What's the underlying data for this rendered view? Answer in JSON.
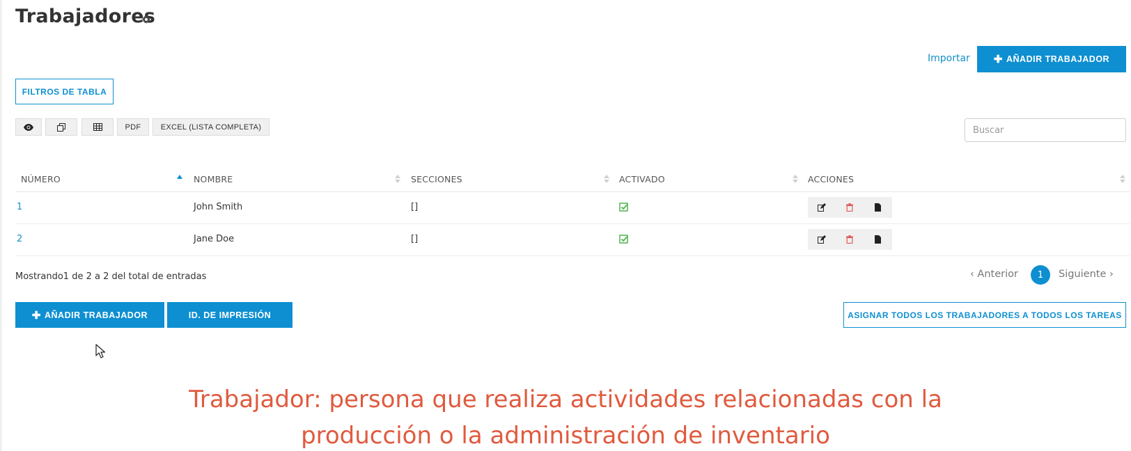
{
  "page": {
    "title": "Trabajadores",
    "title_icon": "gear-icon"
  },
  "header_actions": {
    "import_label": "Importar",
    "add_worker_label": "AÑADIR TRABAJADOR"
  },
  "filters": {
    "label": "FILTROS DE TABLA"
  },
  "toolbar": {
    "buttons": [
      {
        "icon": "eye-icon"
      },
      {
        "icon": "copy-icon"
      },
      {
        "icon": "table-icon"
      },
      {
        "label": "PDF"
      },
      {
        "label": "EXCEL (LISTA COMPLETA)"
      }
    ]
  },
  "search": {
    "placeholder": "Buscar",
    "value": ""
  },
  "table": {
    "columns": [
      "NÚMERO",
      "NOMBRE",
      "SECCIONES",
      "ACTIVADO",
      "ACCIONES"
    ],
    "sorted_column": "NÚMERO",
    "rows": [
      {
        "numero": "1",
        "nombre": "John Smith",
        "secciones": "[]",
        "activado": true
      },
      {
        "numero": "2",
        "nombre": "Jane Doe",
        "secciones": "[]",
        "activado": true
      }
    ],
    "action_icons": [
      "edit-icon",
      "trash-icon",
      "document-icon"
    ]
  },
  "pagination": {
    "info": "Mostrando1 de 2 a 2 del total de entradas",
    "prev_label": "Anterior",
    "current_page": "1",
    "next_label": "Siguiente"
  },
  "bottom_actions": {
    "add_worker_label": "AÑADIR TRABAJADOR",
    "print_id_label": "ID. DE IMPRESIÓN",
    "assign_all_label": "ASIGNAR TODOS LOS TRABAJADORES A TODOS LOS TAREAS"
  },
  "definition": {
    "line1": "Trabajador: persona que realiza actividades relacionadas con la",
    "line2": "producción o la administración de inventario"
  },
  "colors": {
    "accent": "#0e8fd1",
    "link": "#1591c8",
    "check": "#5cb85c",
    "trash": "#e05a5a",
    "definition_text": "#e05a3e"
  }
}
